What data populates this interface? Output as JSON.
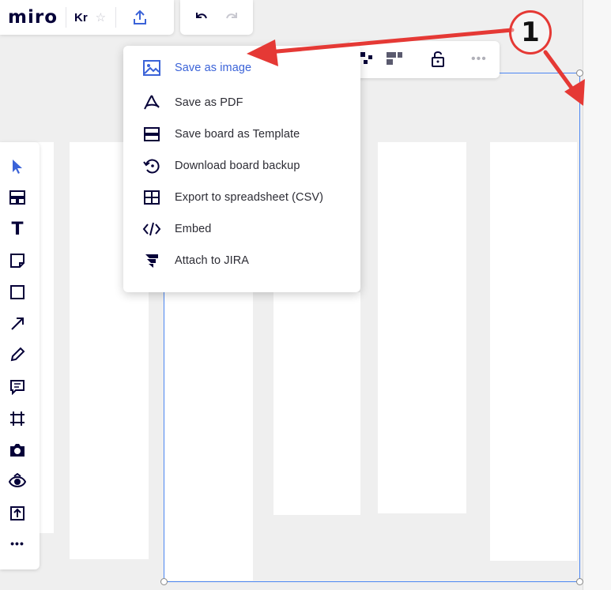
{
  "app": {
    "logo": "miro",
    "board_name": "Kr"
  },
  "top_toolbar": {
    "star_icon": "star-icon",
    "export_icon": "upload-icon",
    "undo_icon": "undo-icon",
    "redo_icon": "redo-icon",
    "right_icons": [
      "grid-icon",
      "layout-icon",
      "unlock-icon",
      "more-icon"
    ]
  },
  "export_menu": {
    "items": [
      {
        "label": "Save as image",
        "icon": "image-icon"
      },
      {
        "label": "Save as PDF",
        "icon": "pdf-icon"
      },
      {
        "label": "Save board as Template",
        "icon": "template-icon"
      },
      {
        "label": "Download board backup",
        "icon": "backup-icon"
      },
      {
        "label": "Export to spreadsheet (CSV)",
        "icon": "table-icon"
      },
      {
        "label": "Embed",
        "icon": "code-icon"
      },
      {
        "label": "Attach to JIRA",
        "icon": "jira-icon"
      }
    ]
  },
  "left_toolbar": {
    "tools": [
      "select-icon",
      "templates-icon",
      "text-icon",
      "sticky-note-icon",
      "shape-icon",
      "arrow-icon",
      "pen-icon",
      "comment-icon",
      "frame-icon",
      "camera-icon",
      "eye-icon",
      "upload-icon",
      "more-icon"
    ]
  },
  "annotation": {
    "number": "1"
  },
  "colors": {
    "accent": "#3b63d8",
    "annotation_red": "#e53935",
    "selection_blue": "#4b86f2",
    "teal_button": "#21c7a8"
  }
}
